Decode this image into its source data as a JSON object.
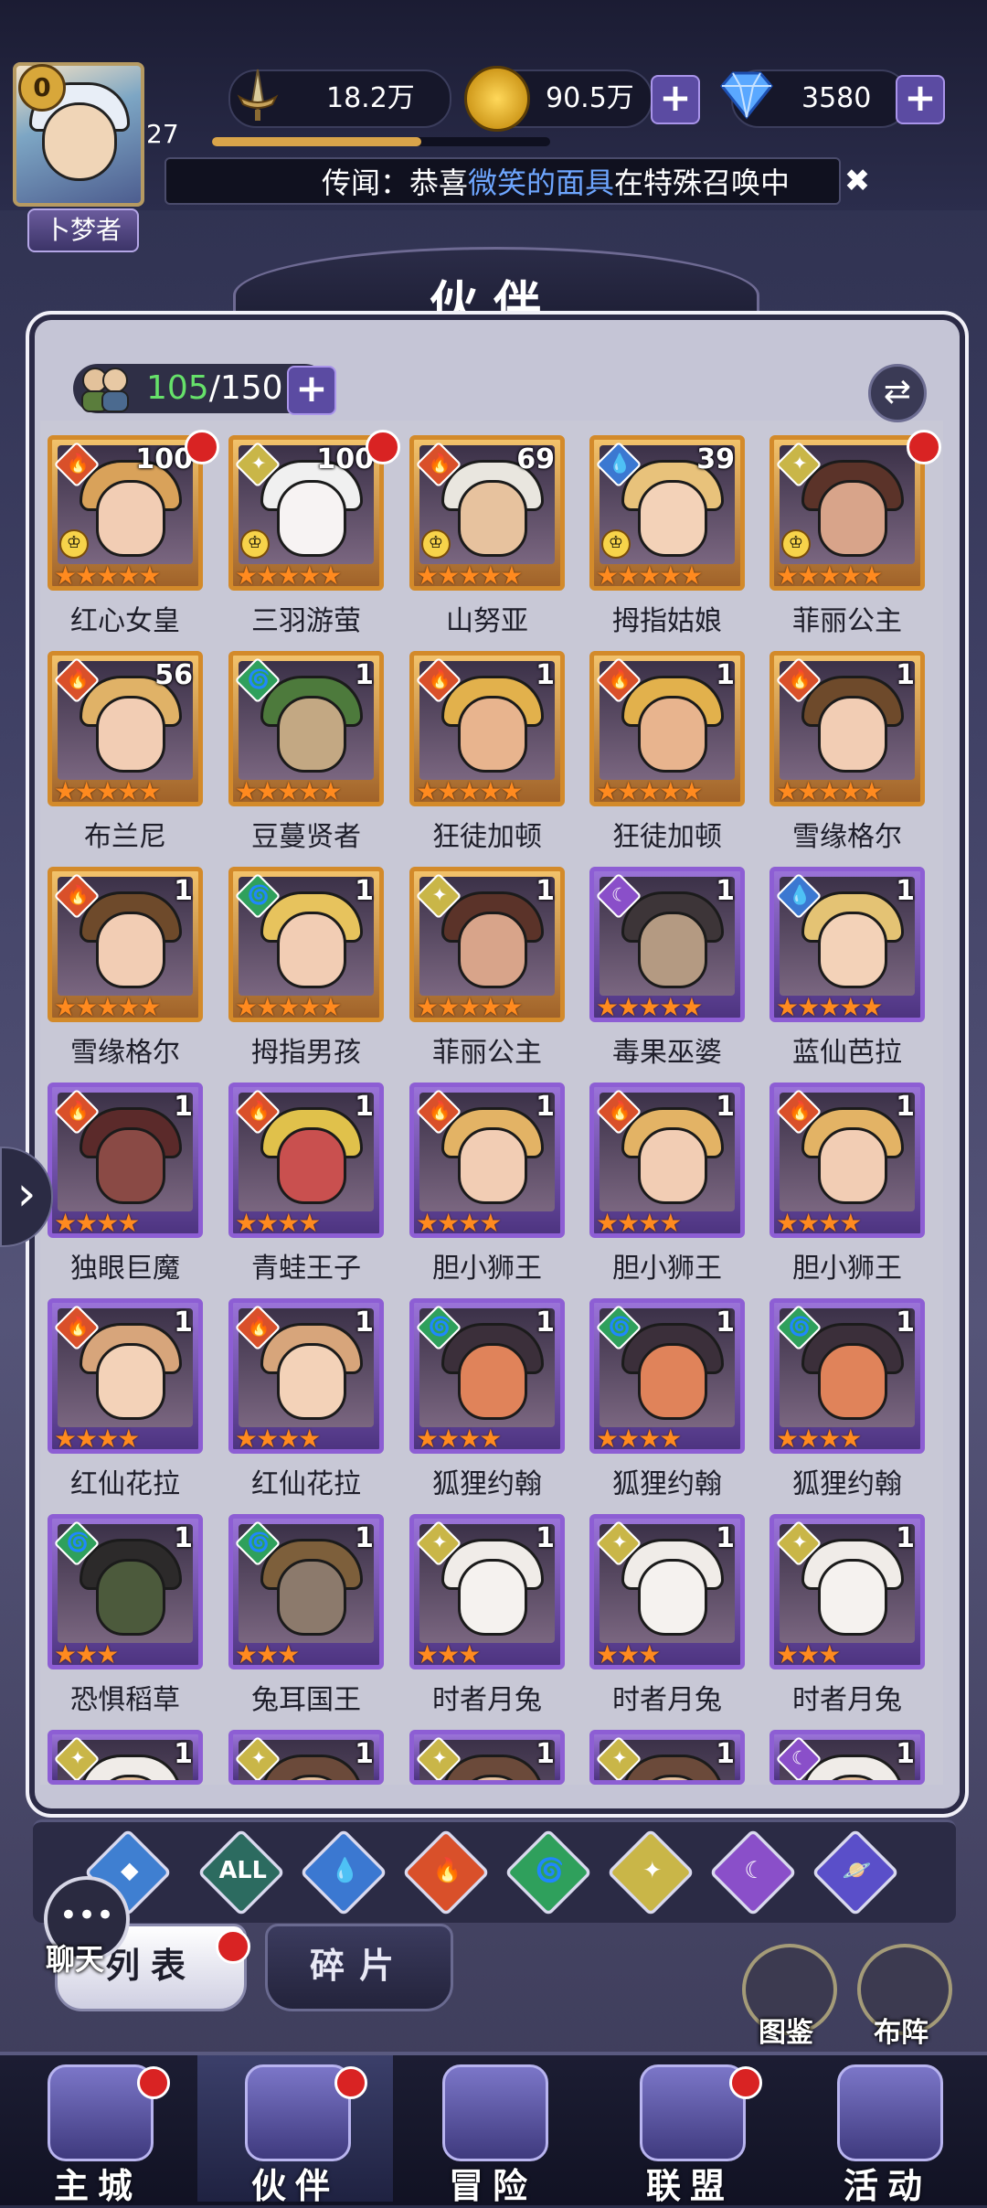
{
  "player": {
    "level_badge": "0",
    "level": "27",
    "title": "卜梦者",
    "exp_progress": 0.62
  },
  "resources": [
    {
      "icon": "sword-power-icon",
      "value": "18.2万",
      "has_plus": false
    },
    {
      "icon": "gold-coin-icon",
      "value": "90.5万",
      "has_plus": true
    },
    {
      "icon": "diamond-icon",
      "value": "3580",
      "has_plus": true
    }
  ],
  "rumor": {
    "prefix": "传闻：恭喜",
    "highlight": "微笑的面具",
    "suffix": "在特殊召唤中",
    "close_icon": "close-icon"
  },
  "page_title": "伙伴",
  "capacity": {
    "current": "105",
    "max": "/150"
  },
  "elements": {
    "fire": {
      "color": "#d9502a",
      "glyph": "🔥"
    },
    "light": {
      "color": "#c9b648",
      "glyph": "✦"
    },
    "water": {
      "color": "#3b78d1",
      "glyph": "💧"
    },
    "wind": {
      "color": "#2fa05c",
      "glyph": "🌀"
    },
    "dark": {
      "color": "#8a4fc9",
      "glyph": "☾"
    }
  },
  "heroes": [
    {
      "name": "红心女皇",
      "level": "100",
      "element": "fire",
      "frame": "gold",
      "stars": 5,
      "crown": true,
      "dot": true,
      "hair": "#d9a25a",
      "skin": "#f2cdb4"
    },
    {
      "name": "三羽游萤",
      "level": "100",
      "element": "light",
      "frame": "gold",
      "stars": 5,
      "crown": true,
      "dot": true,
      "hair": "#f0f0f0",
      "skin": "#f7f3f3"
    },
    {
      "name": "山努亚",
      "level": "69",
      "element": "fire",
      "frame": "gold",
      "stars": 5,
      "crown": true,
      "dot": false,
      "hair": "#e9e6df",
      "skin": "#e7c29e"
    },
    {
      "name": "拇指姑娘",
      "level": "39",
      "element": "water",
      "frame": "gold",
      "stars": 5,
      "crown": true,
      "dot": false,
      "hair": "#e8c27b",
      "skin": "#f3d2b8"
    },
    {
      "name": "菲丽公主",
      "level": "",
      "element": "light",
      "frame": "gold",
      "stars": 5,
      "crown": true,
      "dot": true,
      "hair": "#5b3329",
      "skin": "#d8a48a"
    },
    {
      "name": "布兰尼",
      "level": "56",
      "element": "fire",
      "frame": "gold",
      "stars": 5,
      "crown": false,
      "dot": false,
      "hair": "#e0b267",
      "skin": "#f2cdb4"
    },
    {
      "name": "豆蔓贤者",
      "level": "1",
      "element": "wind",
      "frame": "gold",
      "stars": 5,
      "crown": false,
      "dot": false,
      "hair": "#4d7a3c",
      "skin": "#c3a883"
    },
    {
      "name": "狂徒加顿",
      "level": "1",
      "element": "fire",
      "frame": "gold",
      "stars": 5,
      "crown": false,
      "dot": false,
      "hair": "#e2b14c",
      "skin": "#e8b48e"
    },
    {
      "name": "狂徒加顿",
      "level": "1",
      "element": "fire",
      "frame": "gold",
      "stars": 5,
      "crown": false,
      "dot": false,
      "hair": "#e2b14c",
      "skin": "#e8b48e"
    },
    {
      "name": "雪缘格尔",
      "level": "1",
      "element": "fire",
      "frame": "gold",
      "stars": 5,
      "crown": false,
      "dot": false,
      "hair": "#6e4a2b",
      "skin": "#f2cdb4"
    },
    {
      "name": "雪缘格尔",
      "level": "1",
      "element": "fire",
      "frame": "gold",
      "stars": 5,
      "crown": false,
      "dot": false,
      "hair": "#6e4a2b",
      "skin": "#f2cdb4"
    },
    {
      "name": "拇指男孩",
      "level": "1",
      "element": "wind",
      "frame": "gold",
      "stars": 5,
      "crown": false,
      "dot": false,
      "hair": "#e7c35d",
      "skin": "#f2cdb4"
    },
    {
      "name": "菲丽公主",
      "level": "1",
      "element": "light",
      "frame": "gold",
      "stars": 5,
      "crown": false,
      "dot": false,
      "hair": "#5b3329",
      "skin": "#d8a48a"
    },
    {
      "name": "毒果巫婆",
      "level": "1",
      "element": "dark",
      "frame": "purple",
      "stars": 5,
      "crown": false,
      "dot": false,
      "hair": "#3d3538",
      "skin": "#b49a82"
    },
    {
      "name": "蓝仙芭拉",
      "level": "1",
      "element": "water",
      "frame": "purple",
      "stars": 5,
      "crown": false,
      "dot": false,
      "hair": "#e4c374",
      "skin": "#f3d2b8"
    },
    {
      "name": "独眼巨魔",
      "level": "1",
      "element": "fire",
      "frame": "purple",
      "stars": 4,
      "crown": false,
      "dot": false,
      "hair": "#5b2a2a",
      "skin": "#8a4a45"
    },
    {
      "name": "青蛙王子",
      "level": "1",
      "element": "fire",
      "frame": "purple",
      "stars": 4,
      "crown": false,
      "dot": false,
      "hair": "#e0c14b",
      "skin": "#c9504f"
    },
    {
      "name": "胆小狮王",
      "level": "1",
      "element": "fire",
      "frame": "purple",
      "stars": 4,
      "crown": false,
      "dot": false,
      "hair": "#e3b365",
      "skin": "#f2cdb4"
    },
    {
      "name": "胆小狮王",
      "level": "1",
      "element": "fire",
      "frame": "purple",
      "stars": 4,
      "crown": false,
      "dot": false,
      "hair": "#e3b365",
      "skin": "#f2cdb4"
    },
    {
      "name": "胆小狮王",
      "level": "1",
      "element": "fire",
      "frame": "purple",
      "stars": 4,
      "crown": false,
      "dot": false,
      "hair": "#e3b365",
      "skin": "#f2cdb4"
    },
    {
      "name": "红仙花拉",
      "level": "1",
      "element": "fire",
      "frame": "purple",
      "stars": 4,
      "crown": false,
      "dot": false,
      "hair": "#d7a57b",
      "skin": "#f3d2b8"
    },
    {
      "name": "红仙花拉",
      "level": "1",
      "element": "fire",
      "frame": "purple",
      "stars": 4,
      "crown": false,
      "dot": false,
      "hair": "#d7a57b",
      "skin": "#f3d2b8"
    },
    {
      "name": "狐狸约翰",
      "level": "1",
      "element": "wind",
      "frame": "purple",
      "stars": 4,
      "crown": false,
      "dot": false,
      "hair": "#3b2f3a",
      "skin": "#e0835a"
    },
    {
      "name": "狐狸约翰",
      "level": "1",
      "element": "wind",
      "frame": "purple",
      "stars": 4,
      "crown": false,
      "dot": false,
      "hair": "#3b2f3a",
      "skin": "#e0835a"
    },
    {
      "name": "狐狸约翰",
      "level": "1",
      "element": "wind",
      "frame": "purple",
      "stars": 4,
      "crown": false,
      "dot": false,
      "hair": "#3b2f3a",
      "skin": "#e0835a"
    },
    {
      "name": "恐惧稻草",
      "level": "1",
      "element": "wind",
      "frame": "purple",
      "stars": 3,
      "crown": false,
      "dot": false,
      "hair": "#2c2a2a",
      "skin": "#4c5a3c"
    },
    {
      "name": "兔耳国王",
      "level": "1",
      "element": "wind",
      "frame": "purple",
      "stars": 3,
      "crown": false,
      "dot": false,
      "hair": "#7d5f3b",
      "skin": "#8c7a6c"
    },
    {
      "name": "时者月兔",
      "level": "1",
      "element": "light",
      "frame": "purple",
      "stars": 3,
      "crown": false,
      "dot": false,
      "hair": "#f0ece8",
      "skin": "#f5f2ef"
    },
    {
      "name": "时者月兔",
      "level": "1",
      "element": "light",
      "frame": "purple",
      "stars": 3,
      "crown": false,
      "dot": false,
      "hair": "#f0ece8",
      "skin": "#f5f2ef"
    },
    {
      "name": "时者月兔",
      "level": "1",
      "element": "light",
      "frame": "purple",
      "stars": 3,
      "crown": false,
      "dot": false,
      "hair": "#f0ece8",
      "skin": "#f5f2ef"
    },
    {
      "name": "",
      "level": "1",
      "element": "light",
      "frame": "purple",
      "stars": 0,
      "crown": false,
      "dot": false,
      "hair": "#f0ece8",
      "skin": "#e7c29e"
    },
    {
      "name": "",
      "level": "1",
      "element": "light",
      "frame": "purple",
      "stars": 0,
      "crown": false,
      "dot": false,
      "hair": "#6b4a3a",
      "skin": "#e7c29e"
    },
    {
      "name": "",
      "level": "1",
      "element": "light",
      "frame": "purple",
      "stars": 0,
      "crown": false,
      "dot": false,
      "hair": "#6b4a3a",
      "skin": "#e7c29e"
    },
    {
      "name": "",
      "level": "1",
      "element": "light",
      "frame": "purple",
      "stars": 0,
      "crown": false,
      "dot": false,
      "hair": "#6b4a3a",
      "skin": "#e7c29e"
    },
    {
      "name": "",
      "level": "1",
      "element": "dark",
      "frame": "purple",
      "stars": 0,
      "crown": false,
      "dot": false,
      "hair": "#f0ece8",
      "skin": "#e7c29e"
    }
  ],
  "filters": [
    {
      "key": "base",
      "color": "#3f7fd1",
      "glyph": "◆"
    },
    {
      "key": "all",
      "color": "#2c6b60",
      "glyph": "ALL"
    },
    {
      "key": "water",
      "color": "#3b78d1",
      "glyph": "💧"
    },
    {
      "key": "fire",
      "color": "#d9502a",
      "glyph": "🔥"
    },
    {
      "key": "wind",
      "color": "#2fa05c",
      "glyph": "🌀"
    },
    {
      "key": "light",
      "color": "#c9b648",
      "glyph": "✦"
    },
    {
      "key": "dark",
      "color": "#8a4fc9",
      "glyph": "☾"
    },
    {
      "key": "cosmic",
      "color": "#5a4fc9",
      "glyph": "🪐"
    }
  ],
  "tabs": {
    "list": "列表",
    "fragments": "碎片"
  },
  "chat_label": "聊天",
  "side_buttons": [
    {
      "label": "图鉴"
    },
    {
      "label": "布阵"
    }
  ],
  "nav": [
    {
      "label": "主城",
      "dot": true,
      "active": false
    },
    {
      "label": "伙伴",
      "dot": true,
      "active": true
    },
    {
      "label": "冒险",
      "dot": false,
      "active": false
    },
    {
      "label": "联盟",
      "dot": true,
      "active": false
    },
    {
      "label": "活动",
      "dot": false,
      "active": false
    }
  ]
}
